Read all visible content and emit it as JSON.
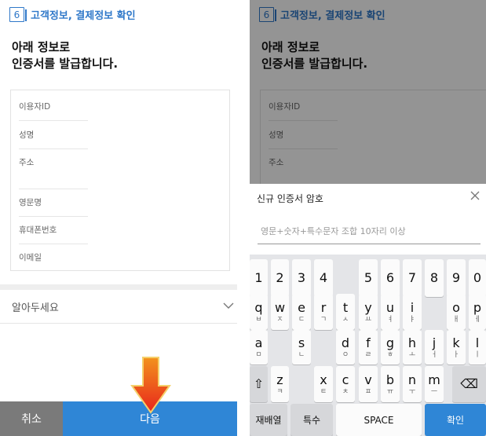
{
  "left": {
    "step_number": "6",
    "step_title": "고객정보, 결제정보 확인",
    "heading_line1": "아래 정보로",
    "heading_line2": "인증서를 발급합니다.",
    "fields": [
      "이용자ID",
      "성명",
      "주소",
      "영문명",
      "휴대폰번호",
      "이메일"
    ],
    "notice_label": "알아두세요",
    "cancel_label": "취소",
    "next_label": "다음"
  },
  "right": {
    "step_number": "6",
    "step_title": "고객정보, 결제정보 확인",
    "heading_line1": "아래 정보로",
    "heading_line2": "인증서를 발급합니다.",
    "fields": [
      "이용자ID",
      "성명",
      "주소"
    ],
    "sheet_title": "신규 인증서 암호",
    "password_placeholder": "영문+숫자+특수문자 조합 10자리 이상",
    "keyboard": {
      "number_row": [
        "1",
        "2",
        "3",
        "4",
        "5",
        "6",
        "7",
        "8",
        "9",
        "0"
      ],
      "row2": [
        {
          "main": "q",
          "sub": "ㅂ"
        },
        {
          "main": "w",
          "sub": "ㅈ"
        },
        {
          "main": "e",
          "sub": "ㄷ"
        },
        {
          "main": "r",
          "sub": "ㄱ"
        },
        {
          "main": "t",
          "sub": "ㅅ"
        },
        {
          "main": "y",
          "sub": "ㅛ"
        },
        {
          "main": "u",
          "sub": "ㅕ"
        },
        {
          "main": "i",
          "sub": "ㅑ"
        },
        {
          "main": "o",
          "sub": "ㅐ"
        },
        {
          "main": "p",
          "sub": "ㅔ"
        }
      ],
      "row3": [
        {
          "main": "a",
          "sub": "ㅁ"
        },
        {
          "main": "s",
          "sub": "ㄴ"
        },
        {
          "main": "d",
          "sub": "ㅇ"
        },
        {
          "main": "f",
          "sub": "ㄹ"
        },
        {
          "main": "g",
          "sub": "ㅎ"
        },
        {
          "main": "h",
          "sub": "ㅗ"
        },
        {
          "main": "j",
          "sub": "ㅓ"
        },
        {
          "main": "k",
          "sub": "ㅏ"
        },
        {
          "main": "l",
          "sub": "ㅣ"
        }
      ],
      "row4": [
        {
          "main": "z",
          "sub": "ㅋ"
        },
        {
          "main": "x",
          "sub": "ㅌ"
        },
        {
          "main": "c",
          "sub": "ㅊ"
        },
        {
          "main": "v",
          "sub": "ㅍ"
        },
        {
          "main": "b",
          "sub": "ㅠ"
        },
        {
          "main": "n",
          "sub": "ㅜ"
        },
        {
          "main": "m",
          "sub": "ㅡ"
        }
      ],
      "shift_symbol": "⇧",
      "backspace_symbol": "⌫",
      "rearrange_label": "재배열",
      "special_label": "특수",
      "space_label": "SPACE",
      "confirm_label": "확인"
    }
  },
  "colors": {
    "accent": "#2f78c9",
    "next_button": "#2f86d6",
    "cancel_button": "#7a7a7a",
    "arrow": "#e8261c"
  },
  "icons": {
    "close": "close-icon",
    "chevron": "chevron-down-icon",
    "arrow": "red-arrow-icon"
  }
}
